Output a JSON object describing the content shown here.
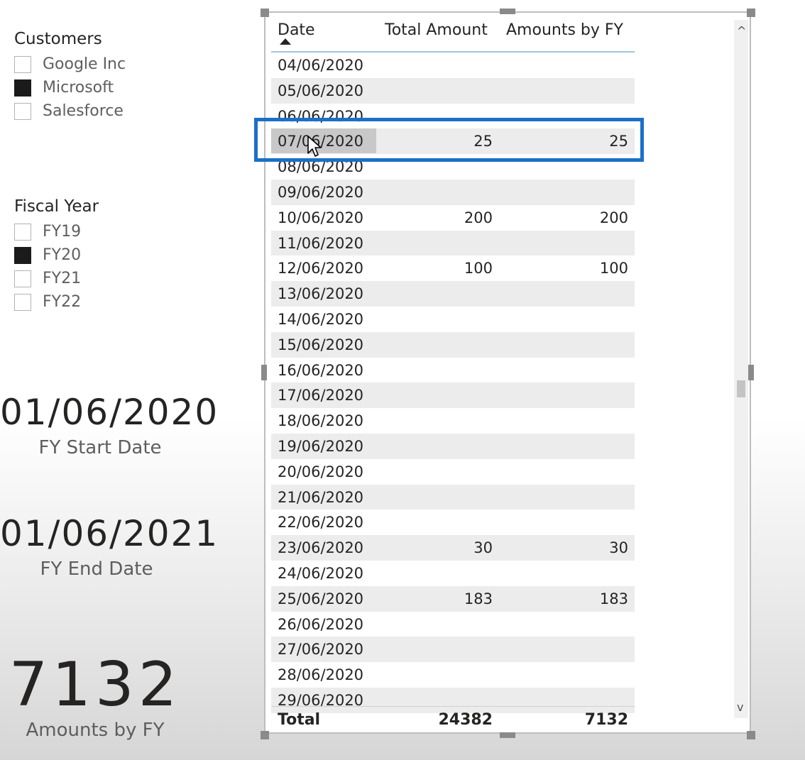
{
  "customers_slicer": {
    "title": "Customers",
    "items": [
      {
        "label": "Google Inc",
        "checked": false
      },
      {
        "label": "Microsoft",
        "checked": true
      },
      {
        "label": "Salesforce",
        "checked": false
      }
    ]
  },
  "fiscal_year_slicer": {
    "title": "Fiscal Year",
    "items": [
      {
        "label": "FY19",
        "checked": false
      },
      {
        "label": "FY20",
        "checked": true
      },
      {
        "label": "FY21",
        "checked": false
      },
      {
        "label": "FY22",
        "checked": false
      }
    ]
  },
  "cards": {
    "start": {
      "value": "01/06/2020",
      "caption": "FY Start Date"
    },
    "end": {
      "value": "01/06/2021",
      "caption": "FY End Date"
    },
    "amount": {
      "value": "7132",
      "caption": "Amounts by FY"
    }
  },
  "table": {
    "headers": {
      "date": "Date",
      "total": "Total Amount",
      "fy": "Amounts by FY"
    },
    "rows": [
      {
        "date": "04/06/2020",
        "total": "",
        "fy": ""
      },
      {
        "date": "05/06/2020",
        "total": "",
        "fy": ""
      },
      {
        "date": "06/06/2020",
        "total": "",
        "fy": ""
      },
      {
        "date": "07/06/2020",
        "total": "25",
        "fy": "25"
      },
      {
        "date": "08/06/2020",
        "total": "",
        "fy": ""
      },
      {
        "date": "09/06/2020",
        "total": "",
        "fy": ""
      },
      {
        "date": "10/06/2020",
        "total": "200",
        "fy": "200"
      },
      {
        "date": "11/06/2020",
        "total": "",
        "fy": ""
      },
      {
        "date": "12/06/2020",
        "total": "100",
        "fy": "100"
      },
      {
        "date": "13/06/2020",
        "total": "",
        "fy": ""
      },
      {
        "date": "14/06/2020",
        "total": "",
        "fy": ""
      },
      {
        "date": "15/06/2020",
        "total": "",
        "fy": ""
      },
      {
        "date": "16/06/2020",
        "total": "",
        "fy": ""
      },
      {
        "date": "17/06/2020",
        "total": "",
        "fy": ""
      },
      {
        "date": "18/06/2020",
        "total": "",
        "fy": ""
      },
      {
        "date": "19/06/2020",
        "total": "",
        "fy": ""
      },
      {
        "date": "20/06/2020",
        "total": "",
        "fy": ""
      },
      {
        "date": "21/06/2020",
        "total": "",
        "fy": ""
      },
      {
        "date": "22/06/2020",
        "total": "",
        "fy": ""
      },
      {
        "date": "23/06/2020",
        "total": "30",
        "fy": "30"
      },
      {
        "date": "24/06/2020",
        "total": "",
        "fy": ""
      },
      {
        "date": "25/06/2020",
        "total": "183",
        "fy": "183"
      },
      {
        "date": "26/06/2020",
        "total": "",
        "fy": ""
      },
      {
        "date": "27/06/2020",
        "total": "",
        "fy": ""
      },
      {
        "date": "28/06/2020",
        "total": "",
        "fy": ""
      },
      {
        "date": "29/06/2020",
        "total": "",
        "fy": ""
      }
    ],
    "total": {
      "label": "Total",
      "total": "24382",
      "fy": "7132"
    }
  },
  "scroll": {
    "up": "^",
    "down": "v"
  },
  "colors": {
    "highlight": "#1c6fc9",
    "header_underline": "#9ec5e6",
    "checked": "#1b1b1b"
  }
}
